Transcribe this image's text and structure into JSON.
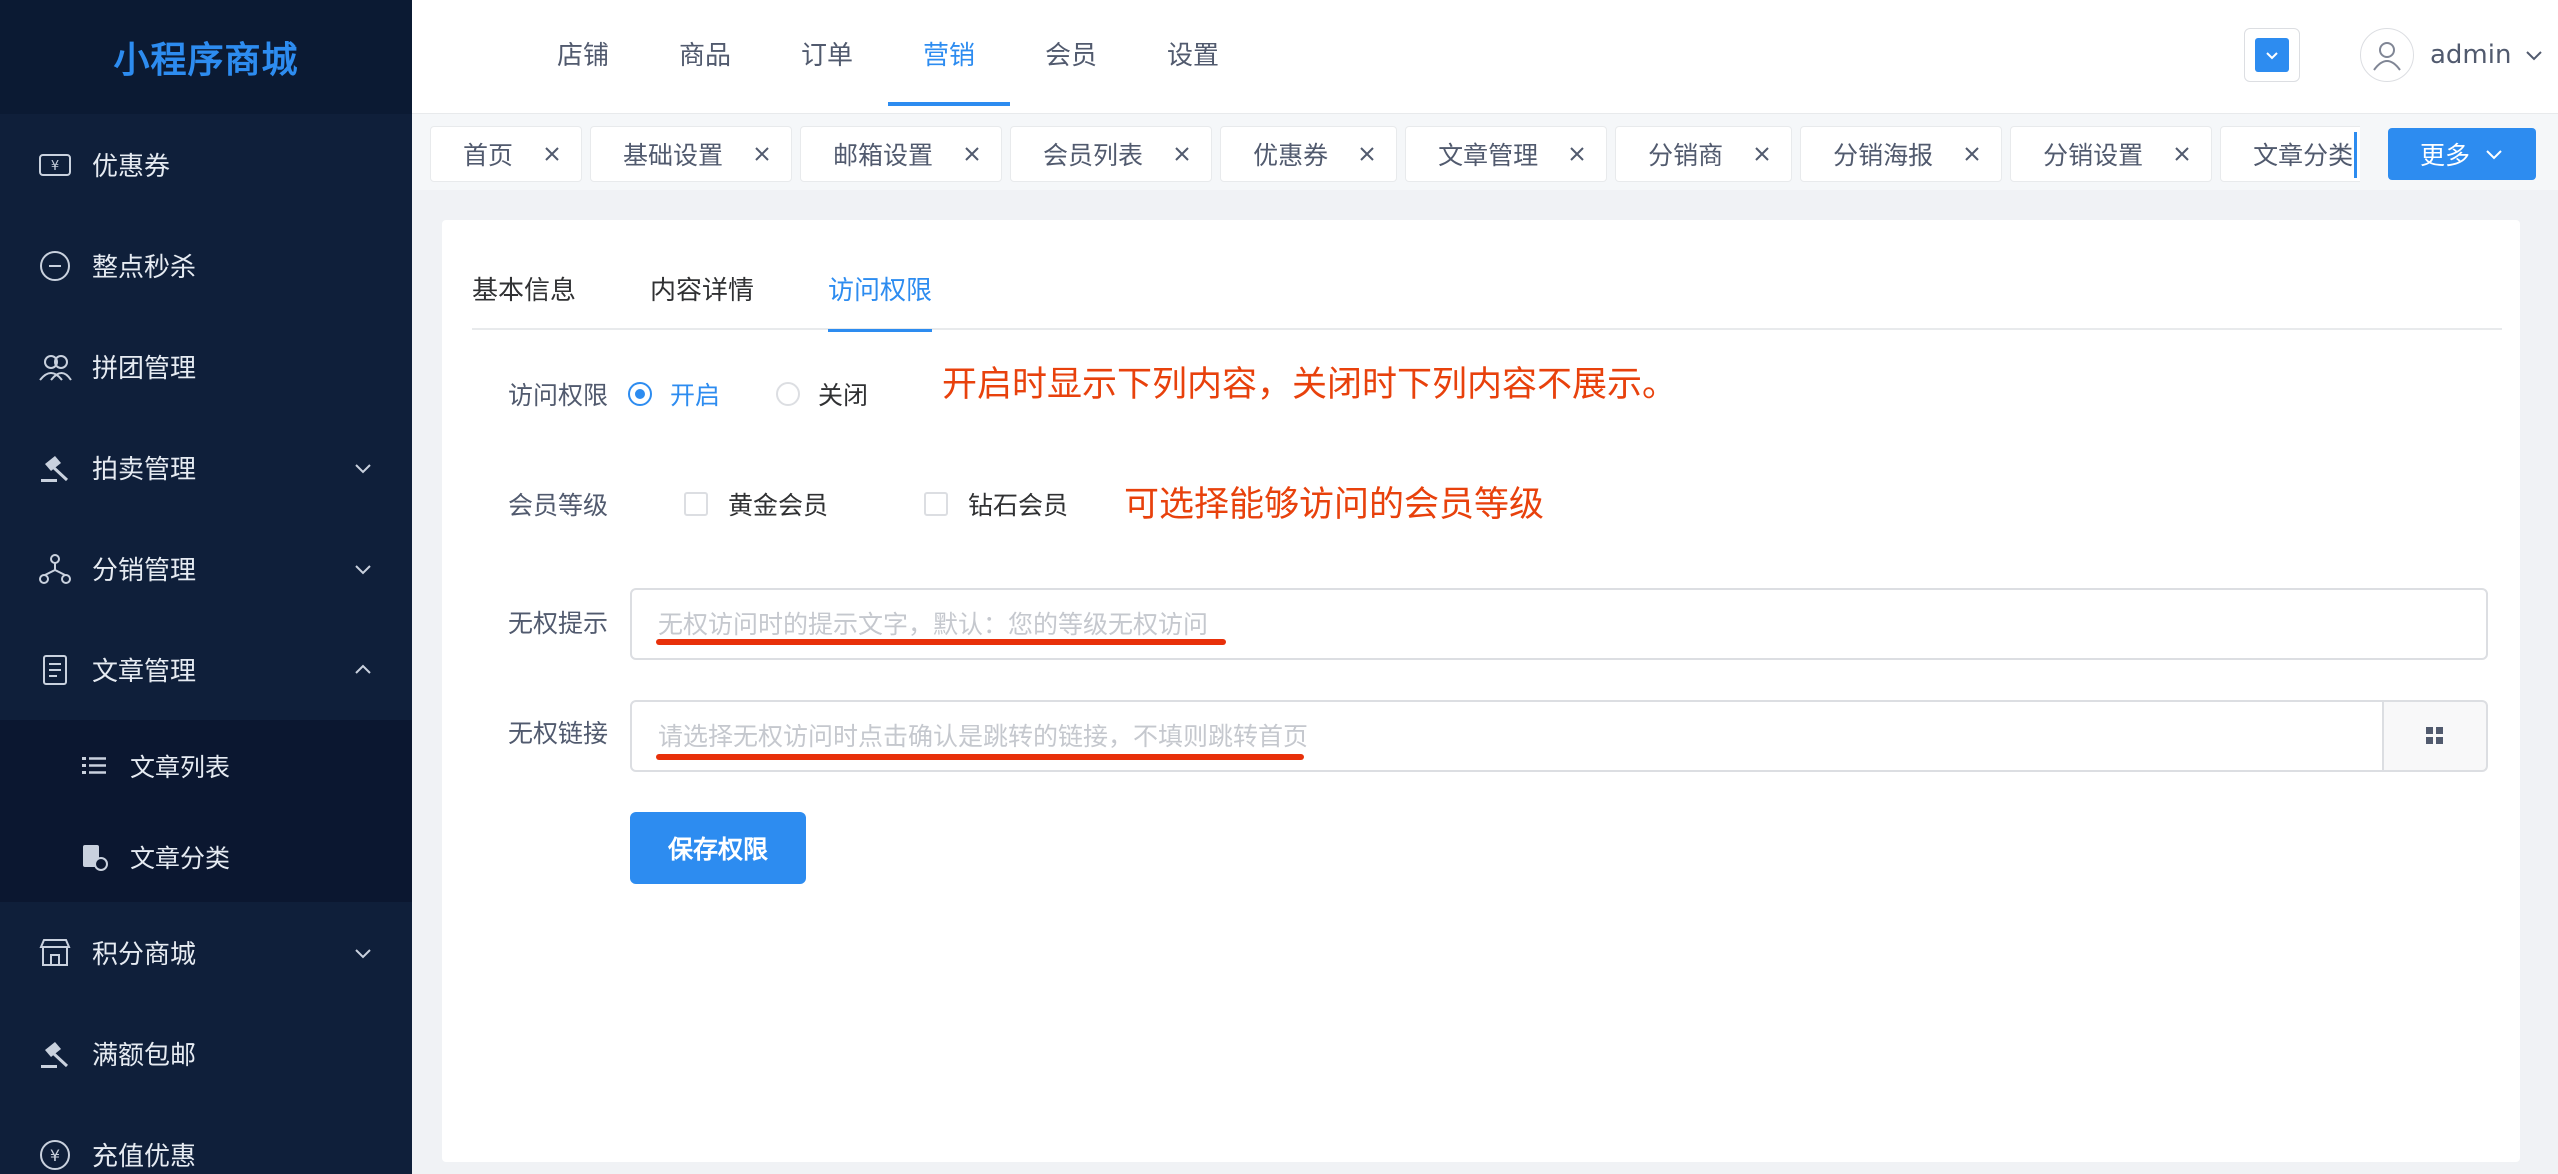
{
  "app": {
    "title": "小程序商城"
  },
  "sidebar": {
    "items": [
      {
        "label": "优惠券",
        "icon": "coupon-icon"
      },
      {
        "label": "整点秒杀",
        "icon": "flash-sale-icon"
      },
      {
        "label": "拼团管理",
        "icon": "group-icon"
      },
      {
        "label": "拍卖管理",
        "icon": "gavel-icon",
        "expandable": true
      },
      {
        "label": "分销管理",
        "icon": "network-icon",
        "expandable": true
      },
      {
        "label": "文章管理",
        "icon": "document-icon",
        "expanded": true
      }
    ],
    "sub_items": [
      {
        "label": "文章列表",
        "icon": "list-icon"
      },
      {
        "label": "文章分类",
        "icon": "category-icon"
      }
    ],
    "items_after": [
      {
        "label": "积分商城",
        "icon": "store-icon",
        "expandable": true
      },
      {
        "label": "满额包邮",
        "icon": "gavel-icon"
      },
      {
        "label": "充值优惠",
        "icon": "yen-icon"
      }
    ]
  },
  "header": {
    "nav": [
      "店铺",
      "商品",
      "订单",
      "营销",
      "会员",
      "设置"
    ],
    "active_nav": "营销",
    "user": "admin"
  },
  "tagbar": {
    "tags": [
      "首页",
      "基础设置",
      "邮箱设置",
      "会员列表",
      "优惠券",
      "文章管理",
      "分销商",
      "分销海报",
      "分销设置",
      "文章分类"
    ],
    "more_label": "更多"
  },
  "tabs": {
    "items": [
      "基本信息",
      "内容详情",
      "访问权限"
    ],
    "active": "访问权限"
  },
  "form": {
    "access_label": "访问权限",
    "access_on": "开启",
    "access_off": "关闭",
    "access_note": "开启时显示下列内容，关闭时下列内容不展示。",
    "level_label": "会员等级",
    "levels": [
      "黄金会员",
      "钻石会员"
    ],
    "level_note": "可选择能够访问的会员等级",
    "tip_label": "无权提示",
    "tip_placeholder": "无权访问时的提示文字，默认：您的等级无权访问",
    "link_label": "无权链接",
    "link_placeholder": "请选择无权访问时点击确认是跳转的链接，不填则跳转首页",
    "save_label": "保存权限"
  },
  "colors": {
    "primary": "#2d8cf0",
    "sidebar": "#0f1f3a",
    "annotation": "#e8410c"
  }
}
